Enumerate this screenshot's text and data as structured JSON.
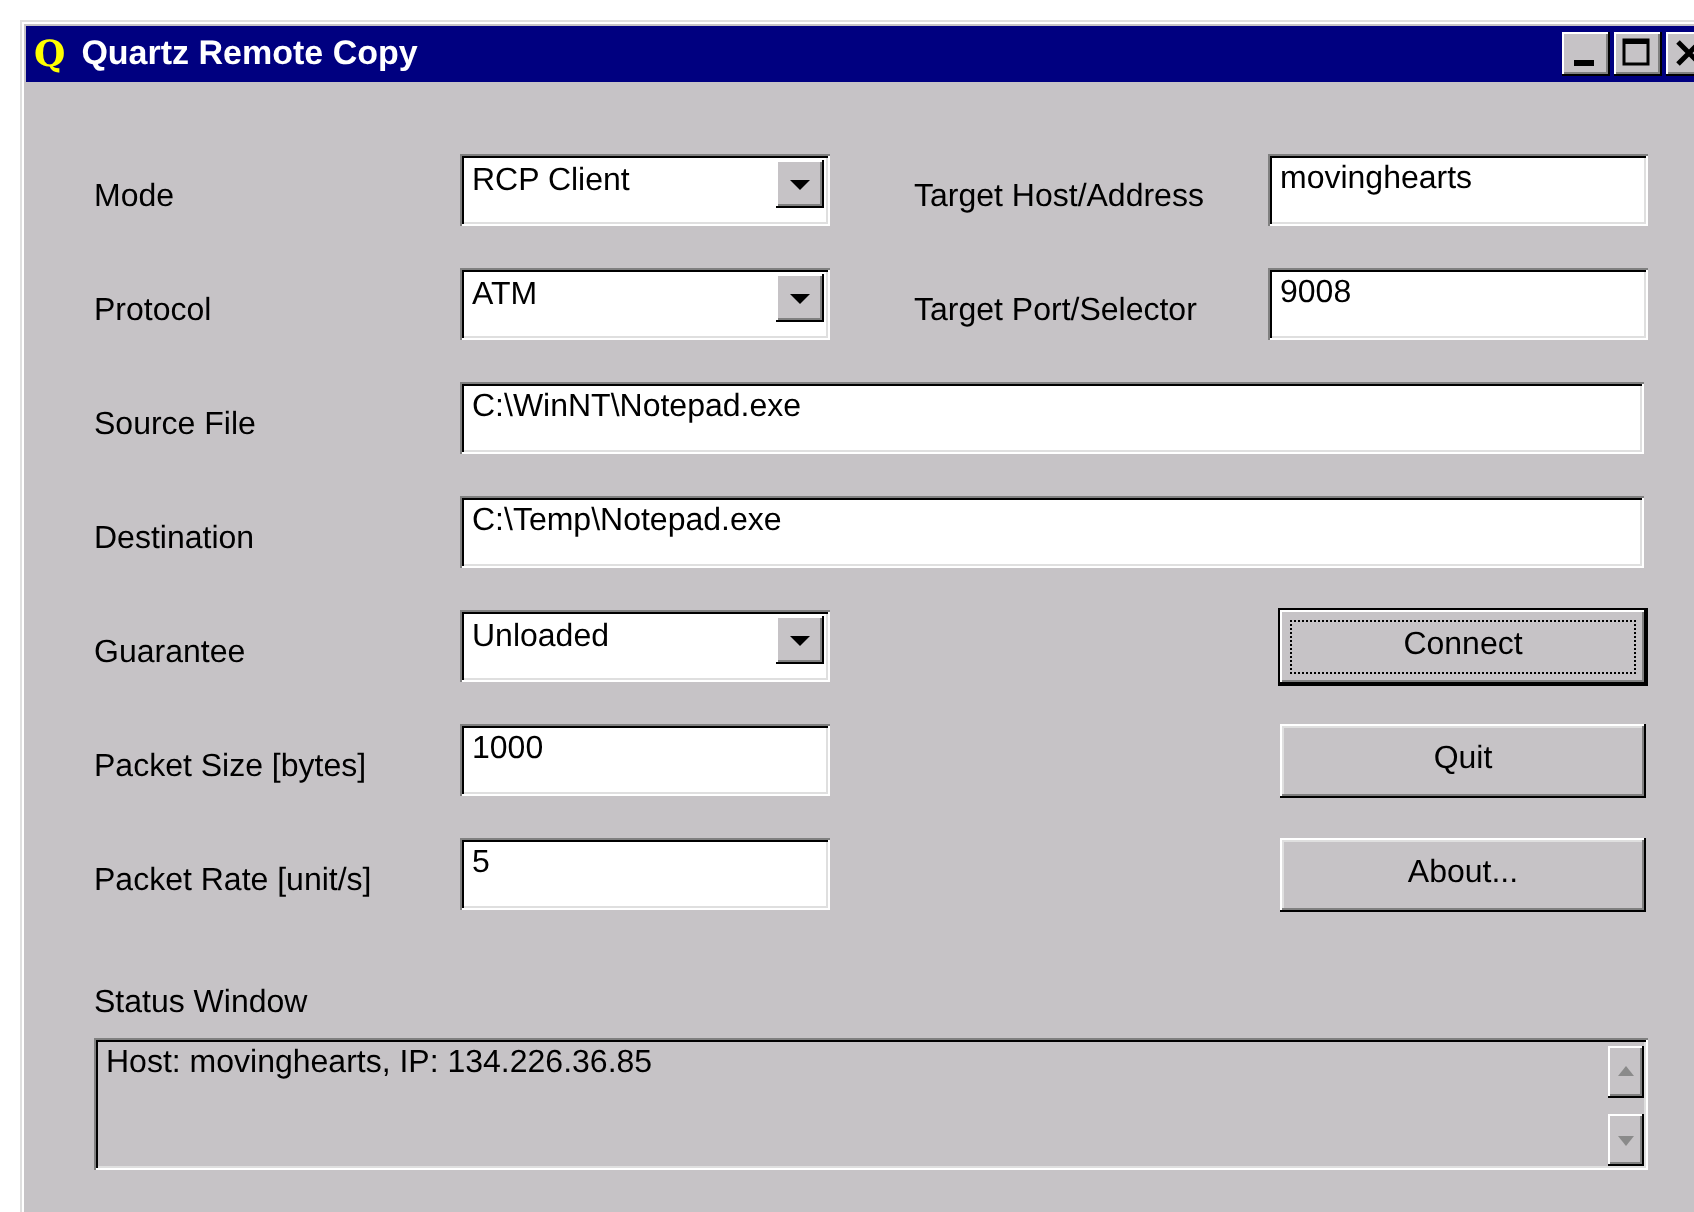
{
  "window": {
    "logo": "Q",
    "title": "Quartz Remote Copy"
  },
  "rows": [
    {
      "label": "Mode",
      "kind": "combo",
      "value": "RCP Client",
      "side": {
        "label": "Target Host/Address",
        "value": "movinghearts"
      }
    },
    {
      "label": "Protocol",
      "kind": "combo",
      "value": "ATM",
      "side": {
        "label": "Target Port/Selector",
        "value": "9008"
      }
    },
    {
      "label": "Source File",
      "kind": "wide",
      "value": "C:\\WinNT\\Notepad.exe"
    },
    {
      "label": "Destination",
      "kind": "wide",
      "value": "C:\\Temp\\Notepad.exe"
    },
    {
      "label": "Guarantee",
      "kind": "combo",
      "value": "Unloaded"
    },
    {
      "label": "Packet Size [bytes]",
      "kind": "text",
      "value": "1000"
    },
    {
      "label": "Packet Rate [unit/s]",
      "kind": "text",
      "value": "5"
    }
  ],
  "buttons": [
    {
      "label": "Connect",
      "focused": true
    },
    {
      "label": "Quit",
      "focused": false
    },
    {
      "label": "About...",
      "focused": false
    }
  ],
  "status": {
    "label": "Status Window",
    "text": "Host: movinghearts, IP: 134.226.36.85"
  }
}
